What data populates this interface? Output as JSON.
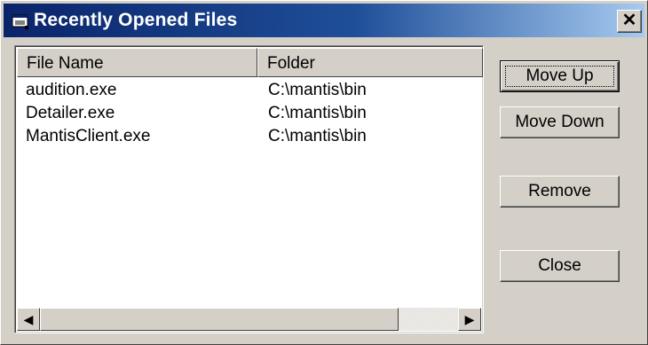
{
  "window": {
    "title": "Recently Opened Files",
    "close_label": "✕",
    "title_icon": "folder-window-icon"
  },
  "list": {
    "columns": [
      "File Name",
      "Folder"
    ],
    "rows": [
      {
        "name": "audition.exe",
        "folder": "C:\\mantis\\bin"
      },
      {
        "name": "Detailer.exe",
        "folder": "C:\\mantis\\bin"
      },
      {
        "name": "MantisClient.exe",
        "folder": "C:\\mantis\\bin"
      }
    ]
  },
  "scrollbar": {
    "left_icon": "scroll-left-arrow-icon",
    "right_icon": "scroll-right-arrow-icon",
    "left_glyph": "◀",
    "right_glyph": "▶"
  },
  "buttons": {
    "move_up": "Move Up",
    "move_down": "Move Down",
    "remove": "Remove",
    "close": "Close"
  },
  "colors": {
    "titlebar_start": "#0a246a",
    "titlebar_end": "#a6caf0",
    "face": "#d4d0c8"
  }
}
